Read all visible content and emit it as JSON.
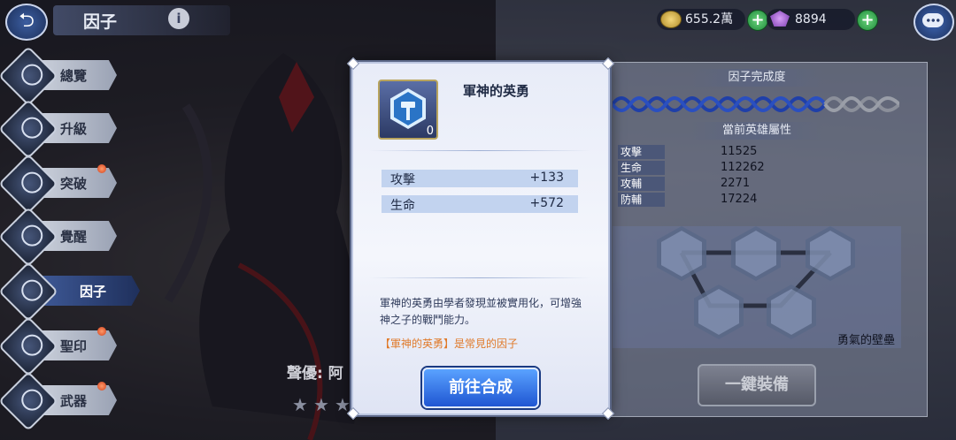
{
  "header": {
    "title": "因子",
    "gold": "655.2萬",
    "gems": "8894"
  },
  "sidebar": {
    "items": [
      {
        "label": "總覽",
        "badge": false
      },
      {
        "label": "升級",
        "badge": false
      },
      {
        "label": "突破",
        "badge": true
      },
      {
        "label": "覺醒",
        "badge": false
      },
      {
        "label": "因子",
        "badge": false,
        "active": true
      },
      {
        "label": "聖印",
        "badge": true
      },
      {
        "label": "武器",
        "badge": true
      }
    ]
  },
  "character": {
    "voice_label": "聲優: 阿",
    "stars_total": 4
  },
  "right_panel": {
    "completion_title": "因子完成度",
    "stats_title": "當前英雄屬性",
    "stats": [
      {
        "name": "攻擊",
        "value": "11525"
      },
      {
        "name": "生命",
        "value": "112262"
      },
      {
        "name": "攻輔",
        "value": "2271"
      },
      {
        "name": "防輔",
        "value": "17224"
      }
    ],
    "set_name": "勇氣的壁壘",
    "equip_label": "一鍵裝備"
  },
  "modal": {
    "item_name": "軍神的英勇",
    "item_count": "0",
    "bonuses": [
      {
        "name": "攻擊",
        "value": "+133"
      },
      {
        "name": "生命",
        "value": "+572"
      }
    ],
    "description": "軍神的英勇由學者發現並被實用化，可增強神之子的戰鬥能力。",
    "rarity_note": "【軍神的英勇】是常見的因子",
    "go_label": "前往合成"
  },
  "colors": {
    "accent_blue": "#1f56d2",
    "rarity_orange": "#e07a2a",
    "badge_red": "#d2401c"
  }
}
